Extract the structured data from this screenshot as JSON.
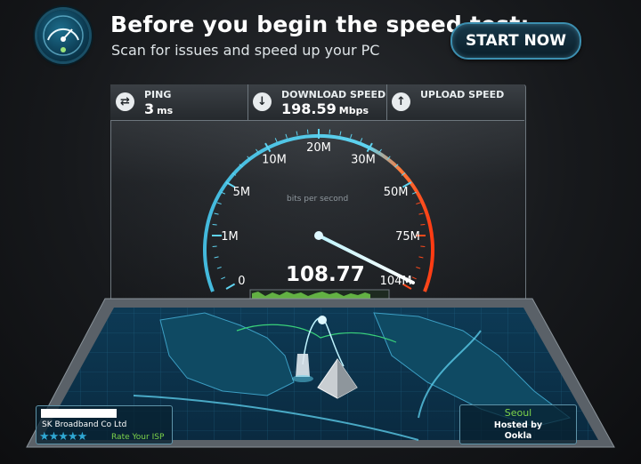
{
  "header": {
    "title": "Before you begin the speed test:",
    "subtitle": "Scan for issues and speed up your PC",
    "start_button": "START NOW",
    "logo_icon": "speedometer-icon"
  },
  "stats": {
    "ping": {
      "label": "PING",
      "value": "3",
      "unit": "ms",
      "icon": "ping-arrows-icon"
    },
    "download": {
      "label": "DOWNLOAD SPEED",
      "value": "198.59",
      "unit": "Mbps",
      "icon": "download-arrow-icon"
    },
    "upload": {
      "label": "UPLOAD SPEED",
      "value": "",
      "unit": "",
      "icon": "upload-arrow-icon"
    }
  },
  "gauge": {
    "scale_labels": [
      "0",
      "1M",
      "5M",
      "10M",
      "20M",
      "30M",
      "50M",
      "75M",
      "104M"
    ],
    "needle_label_index": 8,
    "reading": "108.77",
    "units_label": "bits per second",
    "accent_color": "#5fd3f0",
    "hot_color": "#ff4a1c"
  },
  "isp": {
    "name": "SK Broadband Co Ltd",
    "stars": "★★★★★",
    "rate_label": "Rate Your ISP"
  },
  "server": {
    "city": "Seoul",
    "hosted_by": "Hosted by",
    "host": "Ookla"
  }
}
